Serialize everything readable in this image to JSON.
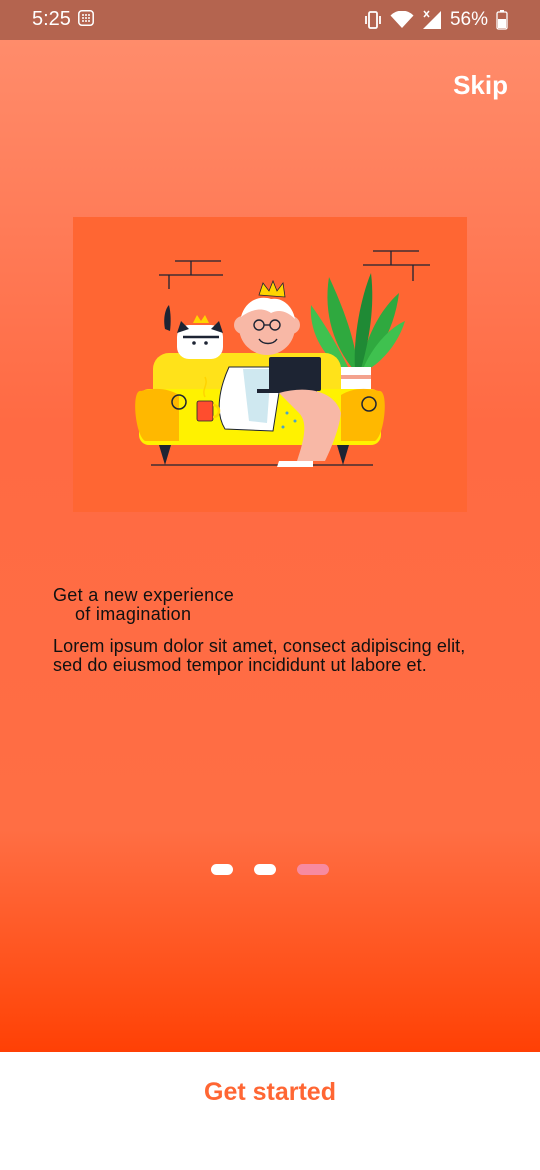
{
  "status_bar": {
    "time": "5:25",
    "battery": "56%",
    "icons": [
      "notification-grid-icon",
      "vibrate-icon",
      "wifi-icon",
      "signal-icon",
      "battery-icon"
    ]
  },
  "onboarding": {
    "skip_label": "Skip",
    "title_line1": "Get a new experience",
    "title_line2": "of imagination",
    "body": "Lorem ipsum dolor sit amet, consect adipiscing elit, sed do eiusmod tempor incididunt ut labore et.",
    "page_count": 3,
    "active_page": 3
  },
  "footer": {
    "cta_label": "Get started"
  },
  "colors": {
    "status_bar": "#b4644f",
    "background_top": "#ff8c6b",
    "background_bottom": "#ff4005",
    "illustration_bg": "#ff6633",
    "accent": "#ff6633",
    "active_dot": "#f78aa0"
  }
}
